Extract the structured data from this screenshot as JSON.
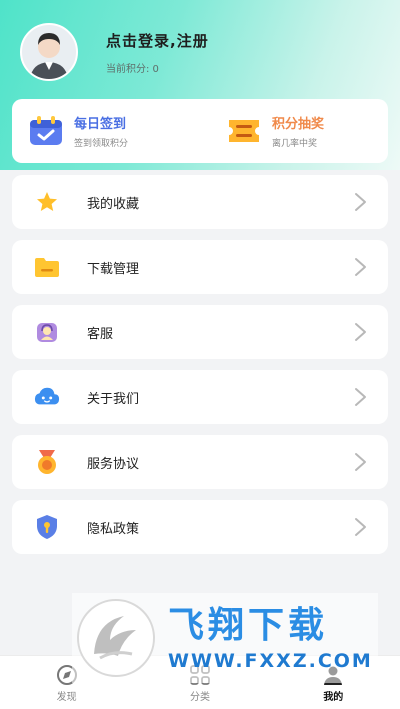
{
  "profile": {
    "login_text": "点击登录,注册",
    "points_text": "当前积分: 0"
  },
  "promo": {
    "checkin": {
      "title": "每日签到",
      "subtitle": "签到领取积分",
      "color": "#4a6fe3"
    },
    "lottery": {
      "title": "积分抽奖",
      "subtitle": "离几率中奖",
      "color": "#f08a4b"
    }
  },
  "menu": [
    {
      "label": "我的收藏",
      "icon": "star-icon"
    },
    {
      "label": "下载管理",
      "icon": "folder-icon"
    },
    {
      "label": "客服",
      "icon": "customer-service-icon"
    },
    {
      "label": "关于我们",
      "icon": "cloud-icon"
    },
    {
      "label": "服务协议",
      "icon": "medal-icon"
    },
    {
      "label": "隐私政策",
      "icon": "shield-icon"
    }
  ],
  "tabbar": [
    {
      "label": "发现",
      "icon": "discover-icon",
      "active": false
    },
    {
      "label": "分类",
      "icon": "category-icon",
      "active": false
    },
    {
      "label": "我的",
      "icon": "profile-icon",
      "active": true
    }
  ],
  "watermark": {
    "title": "飞翔下载",
    "url": "WWW.FXXZ.COM"
  }
}
